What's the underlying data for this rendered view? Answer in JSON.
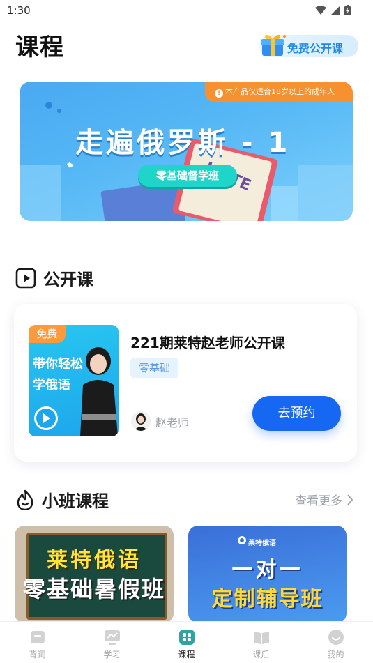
{
  "status_bar": {
    "time": "1:30"
  },
  "header": {
    "title": "课程",
    "free_course_button": "免费公开课"
  },
  "banner": {
    "notice": "本产品仅适合18岁以上的成年人",
    "notice_icon": "info-icon",
    "title": "走遍俄罗斯 - 1",
    "subtitle": "零基础督学班",
    "book_spine_text": "LAITE"
  },
  "open_class_section": {
    "title": "公开课",
    "icon": "play-square-icon",
    "card": {
      "thumb_badge": "免费",
      "thumb_text": "带你轻松学俄语",
      "name": "221期莱特赵老师公开课",
      "tag": "零基础",
      "teacher": "赵老师",
      "action": "去预约"
    }
  },
  "small_class_section": {
    "title": "小班课程",
    "icon": "flame-icon",
    "see_more": "查看更多",
    "cards": [
      {
        "line1": "莱特俄语",
        "line2": "零基础暑假班"
      },
      {
        "brand": "莱特俄语",
        "line1": "一对一",
        "line2": "定制辅导班"
      }
    ]
  },
  "bottom_nav": {
    "items": [
      {
        "label": "背词",
        "icon": "cards-icon",
        "active": false
      },
      {
        "label": "学习",
        "icon": "chart-icon",
        "active": false
      },
      {
        "label": "课程",
        "icon": "grid-icon",
        "active": true
      },
      {
        "label": "课后",
        "icon": "book-icon",
        "active": false
      },
      {
        "label": "我的",
        "icon": "profile-icon",
        "active": false
      }
    ]
  },
  "colors": {
    "primary": "#1668f2",
    "accent_orange": "#f7902e",
    "banner_blue": "#49a9f2",
    "teal": "#1fd4c9",
    "nav_active": "#2fa3a3"
  }
}
